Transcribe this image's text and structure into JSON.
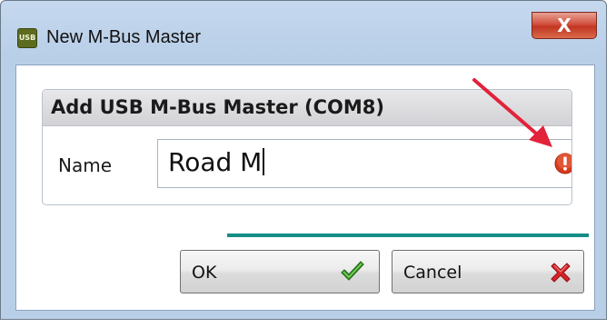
{
  "window": {
    "title": "New M-Bus Master",
    "app_icon_text": "USB",
    "close_glyph": "X"
  },
  "group": {
    "title": "Add USB M-Bus Master (COM8)",
    "name_label": "Name",
    "name_value": "Road M",
    "validation_icon": "error-icon",
    "annotation": "red-arrow-pointing-to-error-icon"
  },
  "buttons": {
    "ok_label": "OK",
    "ok_icon": "checkmark-icon",
    "cancel_label": "Cancel",
    "cancel_icon": "red-x-icon"
  },
  "colors": {
    "accent_line": "#138d86",
    "error": "#d83a1c",
    "annotation_arrow": "#e2233a",
    "check_green": "#3a9a2a",
    "cancel_red": "#d8232a"
  }
}
